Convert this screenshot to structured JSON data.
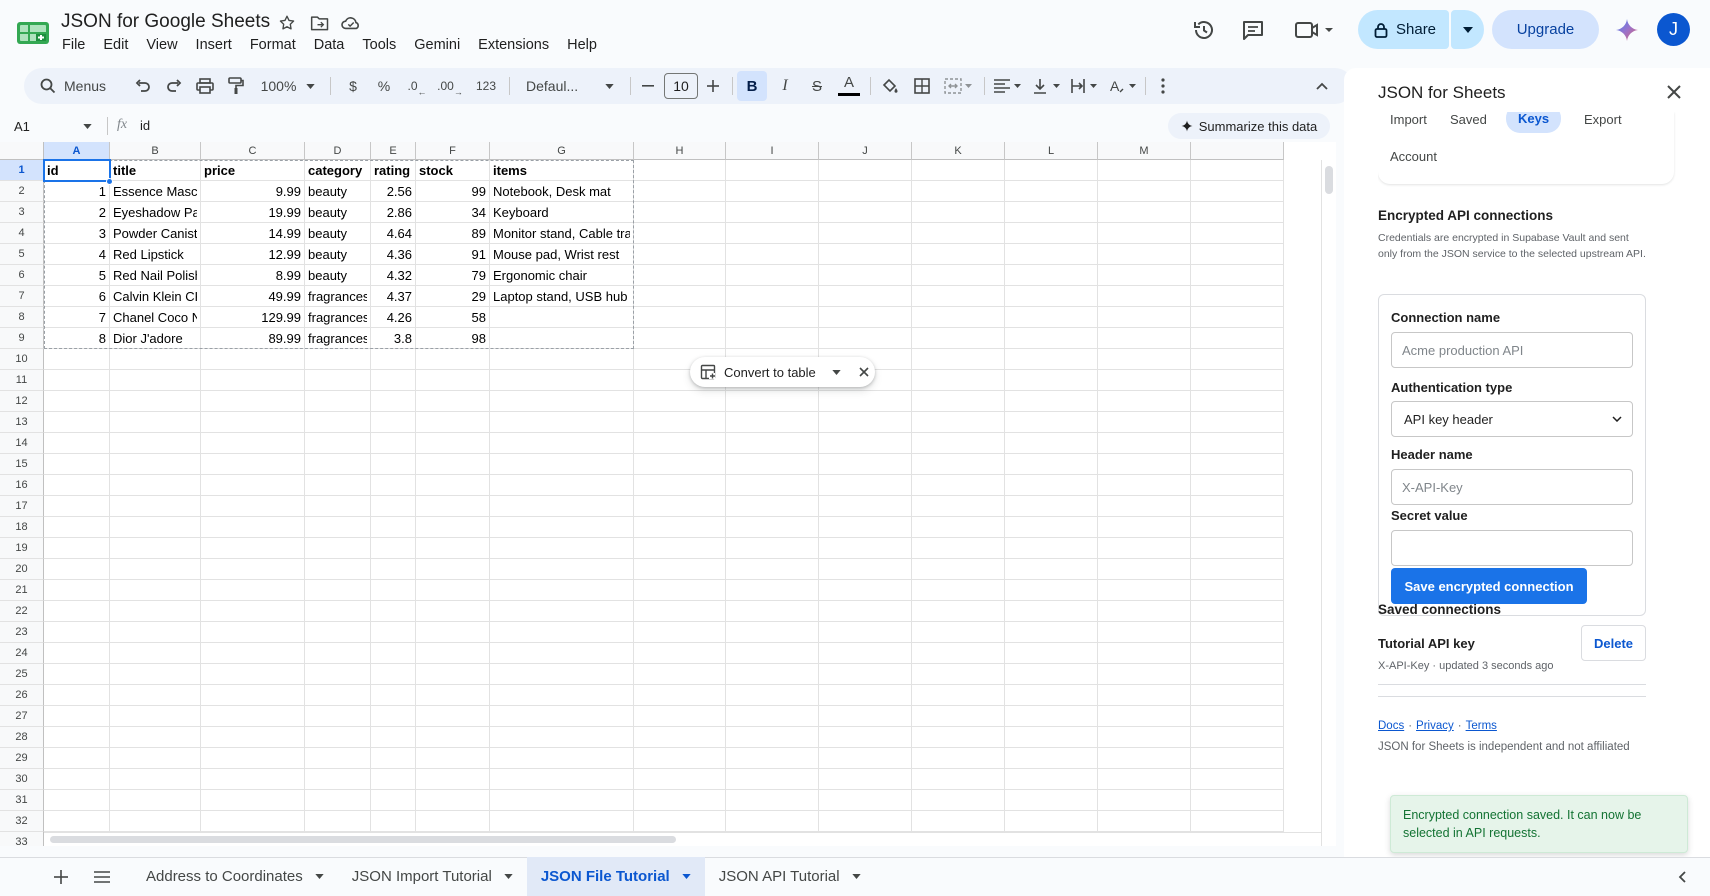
{
  "app": {
    "doc_title": "JSON for Google Sheets",
    "menus": [
      "File",
      "Edit",
      "View",
      "Insert",
      "Format",
      "Data",
      "Tools",
      "Gemini",
      "Extensions",
      "Help"
    ],
    "share_label": "Share",
    "upgrade_label": "Upgrade",
    "avatar_letter": "J"
  },
  "toolbar": {
    "search_label": "Menus",
    "zoom": "100%",
    "currency": "$",
    "percent": "%",
    "dec_less": ".0",
    "dec_more": ".00",
    "number_format": "123",
    "font": "Defaul...",
    "font_size": "10"
  },
  "formula_bar": {
    "name_box": "A1",
    "fx": "fx",
    "value": "id",
    "summarize_label": "Summarize this data"
  },
  "sheet": {
    "columns": [
      "A",
      "B",
      "C",
      "D",
      "E",
      "F",
      "G",
      "H",
      "I",
      "J",
      "K",
      "L",
      "M"
    ],
    "row_numbers": [
      "1",
      "2",
      "3",
      "4",
      "5",
      "6",
      "7",
      "8",
      "9",
      "10",
      "11",
      "12",
      "13",
      "14",
      "15",
      "16",
      "17",
      "18",
      "19",
      "20",
      "21",
      "22",
      "23",
      "24",
      "25",
      "26",
      "27",
      "28",
      "29",
      "30",
      "31",
      "32",
      "33"
    ],
    "rows": [
      [
        "id",
        "title",
        "price",
        "category",
        "rating",
        "stock",
        "items"
      ],
      [
        "1",
        "Essence Masca",
        "9.99",
        "beauty",
        "2.56",
        "99",
        "Notebook, Desk mat"
      ],
      [
        "2",
        "Eyeshadow Pale",
        "19.99",
        "beauty",
        "2.86",
        "34",
        "Keyboard"
      ],
      [
        "3",
        "Powder Caniste",
        "14.99",
        "beauty",
        "4.64",
        "89",
        "Monitor stand, Cable tray"
      ],
      [
        "4",
        "Red Lipstick",
        "12.99",
        "beauty",
        "4.36",
        "91",
        "Mouse pad, Wrist rest"
      ],
      [
        "5",
        "Red Nail Polish",
        "8.99",
        "beauty",
        "4.32",
        "79",
        "Ergonomic chair"
      ],
      [
        "6",
        "Calvin Klein CK",
        "49.99",
        "fragrances",
        "4.37",
        "29",
        "Laptop stand, USB hub"
      ],
      [
        "7",
        "Chanel Coco No",
        "129.99",
        "fragrances",
        "4.26",
        "58",
        ""
      ],
      [
        "8",
        "Dior J'adore",
        "89.99",
        "fragrances",
        "3.8",
        "98",
        ""
      ]
    ],
    "convert_label": "Convert to table"
  },
  "sheet_tabs": [
    {
      "label": "Address to Coordinates",
      "active": false
    },
    {
      "label": "JSON Import Tutorial",
      "active": false
    },
    {
      "label": "JSON File Tutorial",
      "active": true
    },
    {
      "label": "JSON API Tutorial",
      "active": false
    }
  ],
  "panel": {
    "title": "JSON for Sheets",
    "tabs": [
      "Import",
      "Saved",
      "Keys",
      "Export",
      "Account"
    ],
    "active_tab": "Keys",
    "section_title": "Encrypted API connections",
    "section_desc": "Credentials are encrypted in Supabase Vault and sent only from the JSON service to the selected upstream API.",
    "conn_name_label": "Connection name",
    "conn_name_placeholder": "Acme production API",
    "auth_label": "Authentication type",
    "auth_value": "API key header",
    "header_label": "Header name",
    "header_placeholder": "X-API-Key",
    "secret_label": "Secret value",
    "save_button": "Save encrypted connection",
    "saved_title": "Saved connections",
    "saved_item_name": "Tutorial API key",
    "saved_item_meta": "X-API-Key · updated 3 seconds ago",
    "delete_button": "Delete",
    "links": [
      "Docs",
      "Privacy",
      "Terms"
    ],
    "link_sep": "·",
    "footer_text": "JSON for Sheets is independent and not affiliated",
    "toast": "Encrypted connection saved. It can now be selected in API requests."
  },
  "colors": {
    "accent": "#0b57d0",
    "share_bg": "#c2e7ff",
    "save_btn": "#1a73e8",
    "toast_bg": "#e6f4ea",
    "toast_text": "#137333",
    "selection": "#1a73e8"
  }
}
